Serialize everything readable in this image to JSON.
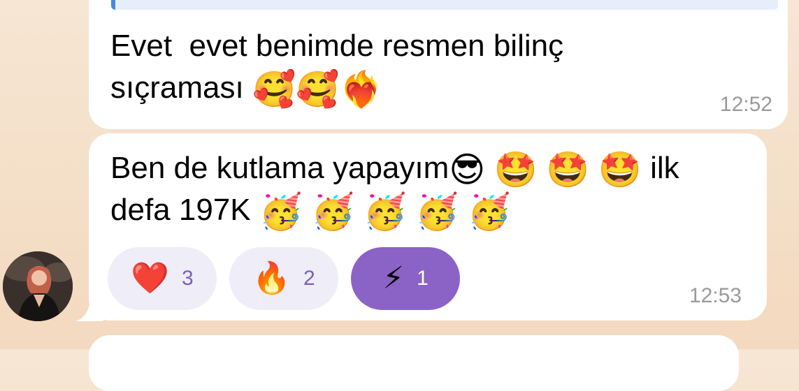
{
  "messages": [
    {
      "text_line1": "Evet  evet benimde resmen bilinç",
      "text_line2": "sıçraması",
      "emojis_line2": [
        "🥰",
        "🥰",
        "❤️‍🔥"
      ],
      "time": "12:52"
    },
    {
      "text_line1": "Ben de kutlama yapayım",
      "emojis_line1": [
        "😎",
        "🤩",
        "🤩",
        "🤩"
      ],
      "text_line1_tail": "ilk",
      "text_line2": "defa 197K",
      "emojis_line2": [
        "🥳",
        "🥳",
        "🥳",
        "🥳",
        "🥳"
      ],
      "time": "12:53",
      "reactions": [
        {
          "emoji": "❤️",
          "count": "3",
          "active": false
        },
        {
          "emoji": "🔥",
          "count": "2",
          "active": false
        },
        {
          "emoji": "⚡",
          "count": "1",
          "active": true
        }
      ]
    }
  ],
  "colors": {
    "background": "#f6e6d3",
    "bubble": "#ffffff",
    "reaction_active": "#8b63c7",
    "reaction_inactive": "#efedf8",
    "reaction_count": "#7b5fb8",
    "timestamp": "#9a9a9a"
  }
}
